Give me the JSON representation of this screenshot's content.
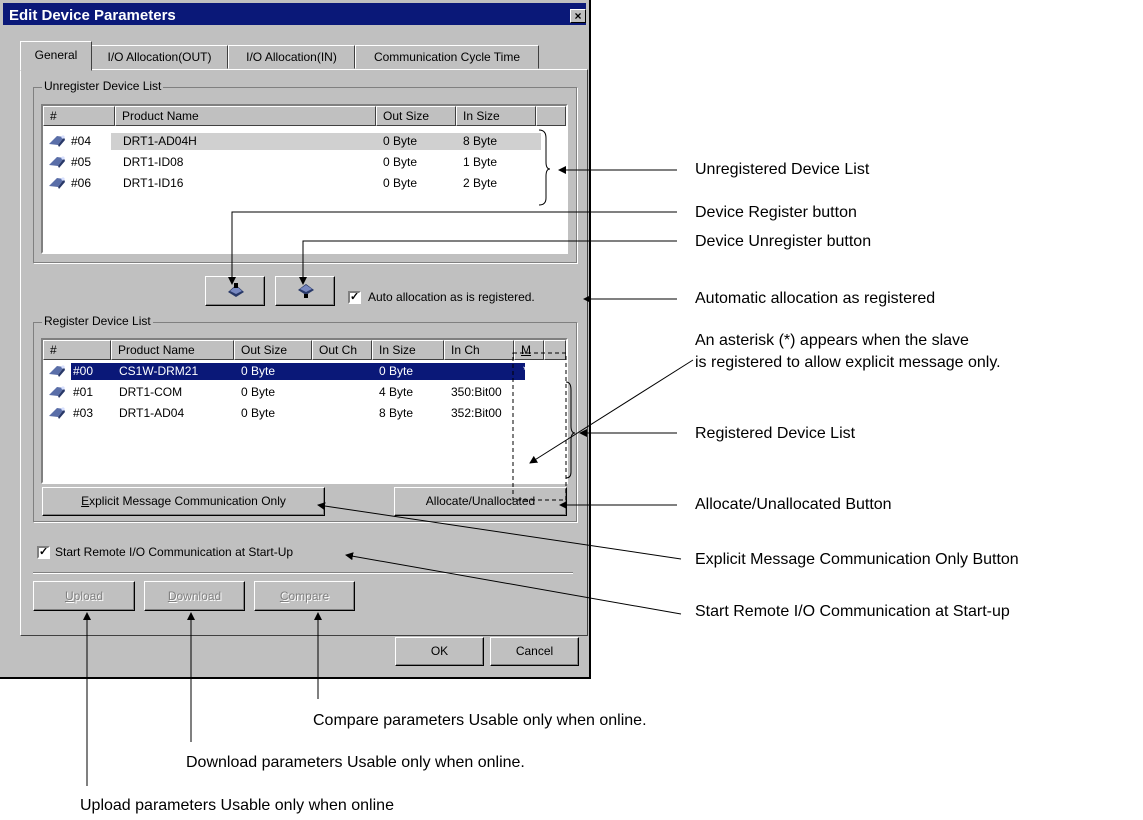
{
  "dialog": {
    "title": "Edit Device Parameters",
    "close_label": "×",
    "tabs": [
      "General",
      "I/O Allocation(OUT)",
      "I/O Allocation(IN)",
      "Communication Cycle Time"
    ],
    "unregister_group_label": "Unregister Device List",
    "unregister_columns": [
      "#",
      "Product Name",
      "Out Size",
      "In Size"
    ],
    "unregister_rows": [
      {
        "num": "#04",
        "product": "DRT1-AD04H",
        "out_size": "0 Byte",
        "in_size": "8 Byte"
      },
      {
        "num": "#05",
        "product": "DRT1-ID08",
        "out_size": "0 Byte",
        "in_size": "1 Byte"
      },
      {
        "num": "#06",
        "product": "DRT1-ID16",
        "out_size": "0 Byte",
        "in_size": "2 Byte"
      }
    ],
    "auto_allocation_label": "Auto allocation as is registered.",
    "auto_allocation_checked": true,
    "register_group_label": "Register Device List",
    "register_columns": [
      "#",
      "Product Name",
      "Out Size",
      "Out Ch",
      "In Size",
      "In Ch",
      "M"
    ],
    "register_rows": [
      {
        "num": "#00",
        "product": "CS1W-DRM21",
        "out_size": "0 Byte",
        "out_ch": "",
        "in_size": "0 Byte",
        "in_ch": "",
        "m": "*"
      },
      {
        "num": "#01",
        "product": "DRT1-COM",
        "out_size": "0 Byte",
        "out_ch": "",
        "in_size": "4 Byte",
        "in_ch": "350:Bit00",
        "m": ""
      },
      {
        "num": "#03",
        "product": "DRT1-AD04",
        "out_size": "0 Byte",
        "out_ch": "",
        "in_size": "8 Byte",
        "in_ch": "352:Bit00",
        "m": ""
      }
    ],
    "explicit_btn": {
      "mnemonic": "E",
      "rest": "xplicit Message Communication Only"
    },
    "allocate_btn": "Allocate/Unallocated",
    "start_remote_label": "Start Remote I/O Communication at Start-Up",
    "start_remote_checked": true,
    "upload_btn": {
      "mnemonic": "U",
      "rest": "pload"
    },
    "download_btn": {
      "mnemonic": "D",
      "rest": "ownload"
    },
    "compare_btn": {
      "mnemonic": "C",
      "rest": "ompare"
    },
    "ok_btn": "OK",
    "cancel_btn": "Cancel"
  },
  "annotations": {
    "unregistered_list": "Unregistered Device List",
    "register_button": "Device Register button",
    "unregister_button": "Device Unregister button",
    "auto_allocation": "Automatic allocation as registered",
    "asterisk_line1": "An asterisk (*) appears when the slave",
    "asterisk_line2": "is registered to allow explicit message only.",
    "registered_list": "Registered Device List",
    "allocate_button": "Allocate/Unallocated Button",
    "explicit_button": "Explicit Message Communication Only Button",
    "start_remote": "Start Remote I/O Communication at Start-up",
    "compare": "Compare parameters Usable only when online.",
    "download": "Download parameters Usable only when online.",
    "upload": "Upload parameters Usable only when online"
  },
  "colors": {
    "titlebar": "#0a1878",
    "dialog_face": "#c0c0c0",
    "selection": "#0a1878",
    "list_bg": "#ffffff"
  }
}
